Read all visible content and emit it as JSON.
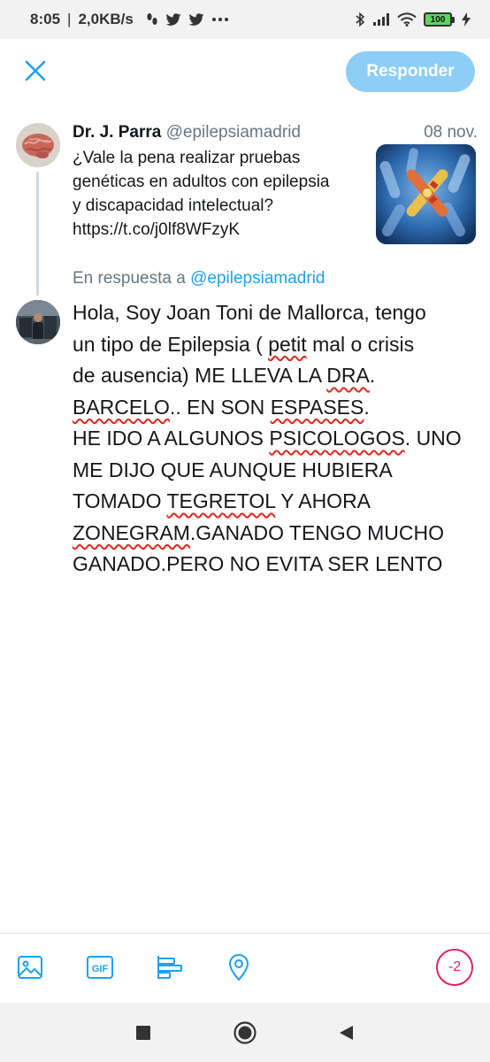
{
  "status_bar": {
    "time": "8:05",
    "separator": "|",
    "speed": "2,0KB/s",
    "battery": "100",
    "icons": [
      "footsteps-icon",
      "twitter-bird-icon",
      "twitter-bird-icon",
      "more-dots-icon",
      "bluetooth-icon",
      "signal-icon",
      "wifi-icon",
      "charging-icon"
    ]
  },
  "header": {
    "reply_button": "Responder",
    "accent": "#1da1f2",
    "reply_button_color": "#8ecdf5"
  },
  "original_tweet": {
    "name": "Dr. J. Parra",
    "handle": "@epilepsiamadrid",
    "date": "08 nov.",
    "lines": [
      "¿Vale la pena realizar pruebas",
      "genéticas en adultos con epilepsia",
      "y discapacidad intelectual?",
      "https://t.co/j0lf8WFzyK"
    ]
  },
  "reply": {
    "prefix": "En respuesta a",
    "handle": "@epilepsiamadrid",
    "lines": [
      [
        "Hola, Soy Joan Toni de Mallorca, tengo"
      ],
      [
        "un tipo de Epilepsia ( ",
        "petit",
        " mal o crisis"
      ],
      [
        "de ausencia) ME LLEVA LA ",
        "DRA",
        "."
      ],
      [
        "BARCELO",
        ".. EN SON ",
        "ESPASES",
        "."
      ],
      [
        "HE IDO A ALGUNOS ",
        "PSICOLOGOS",
        ". UNO"
      ],
      [
        "ME DIJO QUE AUNQUE HUBIERA"
      ],
      [
        "TOMADO ",
        "TEGRETOL",
        " Y AHORA"
      ],
      [
        "ZONEGRAM",
        ".GANADO TENGO MUCHO"
      ],
      [
        "GANADO.PERO NO EVITA SER LENTO"
      ]
    ],
    "misspelled": [
      "petit",
      "DRA",
      "BARCELO",
      "ESPASES",
      "PSICOLOGOS",
      "TEGRETOL",
      "ZONEGRAM"
    ],
    "spellcheck_color": "#e0281e"
  },
  "toolbar": {
    "items": [
      "image-icon",
      "gif-icon",
      "poll-icon",
      "location-icon"
    ],
    "gif_label": "GIF",
    "char_counter": "-2",
    "counter_color": "#e0245e"
  },
  "nav_bar": {
    "items": [
      "recents-square-icon",
      "home-circle-icon",
      "back-triangle-icon"
    ]
  }
}
